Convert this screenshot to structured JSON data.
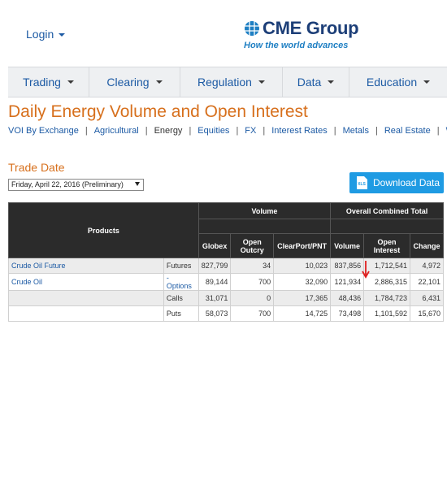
{
  "header": {
    "login_label": "Login",
    "logo_name": "CME Group",
    "logo_tagline": "How the world advances"
  },
  "nav": {
    "items": [
      {
        "label": "Trading"
      },
      {
        "label": "Clearing"
      },
      {
        "label": "Regulation"
      },
      {
        "label": "Data"
      },
      {
        "label": "Education"
      }
    ]
  },
  "page": {
    "title": "Daily Energy Volume and Open Interest"
  },
  "subnav": {
    "items": [
      "VOI By Exchange",
      "Agricultural",
      "Energy",
      "Equities",
      "FX",
      "Interest Rates",
      "Metals",
      "Real Estate",
      "W"
    ],
    "selected": "Energy"
  },
  "trade_date": {
    "label": "Trade Date",
    "selected": "Friday, April 22, 2016 (Preliminary)"
  },
  "download_label": "Download Data",
  "download_icon_text": "XLS",
  "table": {
    "products_header": "Products",
    "volume_header": "Volume",
    "oi_header": "Overall Combined Total",
    "columns": {
      "globex": "Globex",
      "open_outcry": "Open Outcry",
      "clearport": "ClearPort/PNT",
      "volume": "Volume",
      "open_interest": "Open Interest",
      "change": "Change"
    },
    "rows": [
      {
        "product": "Crude Oil Future",
        "type": "Futures",
        "globex": "827,799",
        "open_outcry": "34",
        "clearport": "10,023",
        "volume": "837,856",
        "open_interest": "1,712,541",
        "change": "4,972"
      },
      {
        "product": "Crude Oil",
        "type": "- Options",
        "globex": "89,144",
        "open_outcry": "700",
        "clearport": "32,090",
        "volume": "121,934",
        "open_interest": "2,886,315",
        "change": "22,101"
      },
      {
        "product": "",
        "type": "Calls",
        "globex": "31,071",
        "open_outcry": "0",
        "clearport": "17,365",
        "volume": "48,436",
        "open_interest": "1,784,723",
        "change": "6,431"
      },
      {
        "product": "",
        "type": "Puts",
        "globex": "58,073",
        "open_outcry": "700",
        "clearport": "14,725",
        "volume": "73,498",
        "open_interest": "1,101,592",
        "change": "15,670"
      }
    ]
  },
  "colors": {
    "brand_navy": "#1d3f78",
    "tagline_blue": "#1e7fc3",
    "link_blue": "#1c5aa4",
    "title_orange": "#d7701d",
    "download_blue": "#1f9be3",
    "table_header": "#2b2b2b",
    "annotation_red": "#e02020"
  }
}
